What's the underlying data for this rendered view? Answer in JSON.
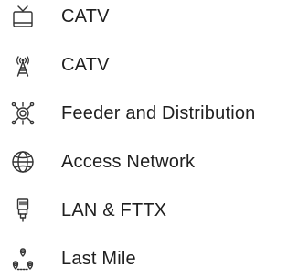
{
  "menu": {
    "items": [
      {
        "label": "CATV",
        "icon": "tv-icon"
      },
      {
        "label": "CATV",
        "icon": "antenna-tower-icon"
      },
      {
        "label": "Feeder and Distribution",
        "icon": "network-hub-icon"
      },
      {
        "label": "Access Network",
        "icon": "globe-icon"
      },
      {
        "label": "LAN & FTTX",
        "icon": "ethernet-plug-icon"
      },
      {
        "label": "Last Mile",
        "icon": "location-pins-icon"
      }
    ]
  },
  "colors": {
    "text": "#1f1f1f",
    "icon": "#333333",
    "background": "#ffffff"
  }
}
